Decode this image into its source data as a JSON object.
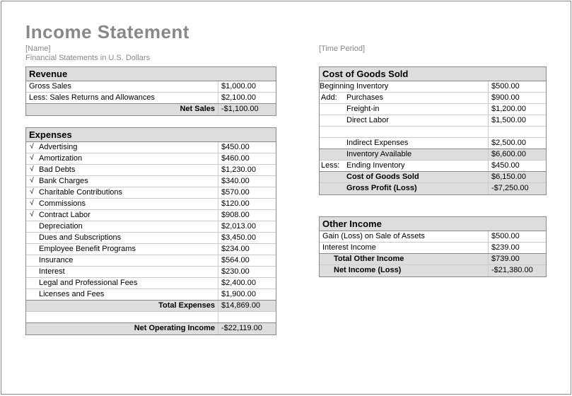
{
  "title": "Income Statement",
  "name_placeholder": "[Name]",
  "period_placeholder": "[Time Period]",
  "subtitle": "Financial Statements in U.S. Dollars",
  "revenue": {
    "header": "Revenue",
    "rows": [
      {
        "label": "Gross Sales",
        "value": "$1,000.00"
      },
      {
        "label": "Less: Sales Returns and Allowances",
        "value": "$2,100.00"
      }
    ],
    "net_label": "Net Sales",
    "net_value": "-$1,100.00"
  },
  "expenses": {
    "header": "Expenses",
    "rows": [
      {
        "chk": "√",
        "label": "Advertising",
        "value": "$450.00"
      },
      {
        "chk": "√",
        "label": "Amortization",
        "value": "$460.00"
      },
      {
        "chk": "√",
        "label": "Bad Debts",
        "value": "$1,230.00"
      },
      {
        "chk": "√",
        "label": "Bank Charges",
        "value": "$340.00"
      },
      {
        "chk": "√",
        "label": "Charitable Contributions",
        "value": "$570.00"
      },
      {
        "chk": "√",
        "label": "Commissions",
        "value": "$120.00"
      },
      {
        "chk": "√",
        "label": "Contract Labor",
        "value": "$908.00"
      },
      {
        "chk": "",
        "label": "Depreciation",
        "value": "$2,013.00"
      },
      {
        "chk": "",
        "label": "Dues and Subscriptions",
        "value": "$3,450.00"
      },
      {
        "chk": "",
        "label": "Employee Benefit Programs",
        "value": "$234.00"
      },
      {
        "chk": "",
        "label": "Insurance",
        "value": "$564.00"
      },
      {
        "chk": "",
        "label": "Interest",
        "value": "$230.00"
      },
      {
        "chk": "",
        "label": "Legal and Professional Fees",
        "value": "$2,400.00"
      },
      {
        "chk": "",
        "label": "Licenses and Fees",
        "value": "$1,900.00"
      }
    ],
    "total_label": "Total Expenses",
    "total_value": "$14,869.00",
    "net_label": "Net Operating Income",
    "net_value": "-$22,119.00"
  },
  "cogs": {
    "header": "Cost of Goods Sold",
    "beg_label": "Beginning Inventory",
    "beg_value": "$500.00",
    "add_label": "Add:",
    "purchases_label": "Purchases",
    "purchases_value": "$900.00",
    "freight_label": "Freight-in",
    "freight_value": "$1,200.00",
    "labor_label": "Direct Labor",
    "labor_value": "$1,500.00",
    "indirect_label": "Indirect Expenses",
    "indirect_value": "$2,500.00",
    "avail_label": "Inventory Available",
    "avail_value": "$6,600.00",
    "less_label": "Less:",
    "ending_label": "Ending Inventory",
    "ending_value": "$450.00",
    "cogs_label": "Cost of Goods Sold",
    "cogs_value": "$6,150.00",
    "gross_label": "Gross Profit (Loss)",
    "gross_value": "-$7,250.00"
  },
  "other": {
    "header": "Other Income",
    "rows": [
      {
        "label": "Gain (Loss) on Sale of Assets",
        "value": "$500.00"
      },
      {
        "label": "Interest Income",
        "value": "$239.00"
      }
    ],
    "total_label": "Total Other Income",
    "total_value": "$739.00",
    "net_label": "Net Income (Loss)",
    "net_value": "-$21,380.00"
  }
}
